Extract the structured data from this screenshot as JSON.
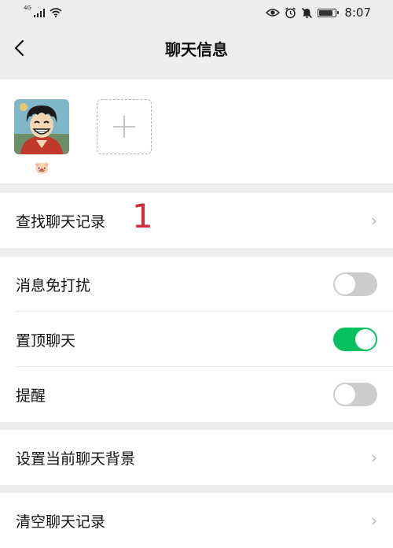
{
  "status_bar": {
    "network": "4G",
    "time": "8:07",
    "battery_level": 0.75,
    "icons": [
      "signal-icon",
      "wifi-icon",
      "eye-icon",
      "alarm-icon",
      "mute-icon",
      "battery-icon"
    ]
  },
  "header": {
    "title": "聊天信息",
    "back_icon": "back-arrow-icon"
  },
  "members": {
    "avatar_icon": "luffy-avatar",
    "badge": "🐷",
    "add_icon": "plus-icon"
  },
  "search_history": {
    "label": "查找聊天记录",
    "annotation": "1"
  },
  "settings": {
    "mute_label": "消息免打扰",
    "mute_on": false,
    "pin_label": "置顶聊天",
    "pin_on": true,
    "remind_label": "提醒",
    "remind_on": false
  },
  "background": {
    "label": "设置当前聊天背景"
  },
  "clear": {
    "label": "清空聊天记录"
  },
  "colors": {
    "toggle_on": "#07c160",
    "annotation": "#cf2e3c",
    "background": "#ededed"
  }
}
